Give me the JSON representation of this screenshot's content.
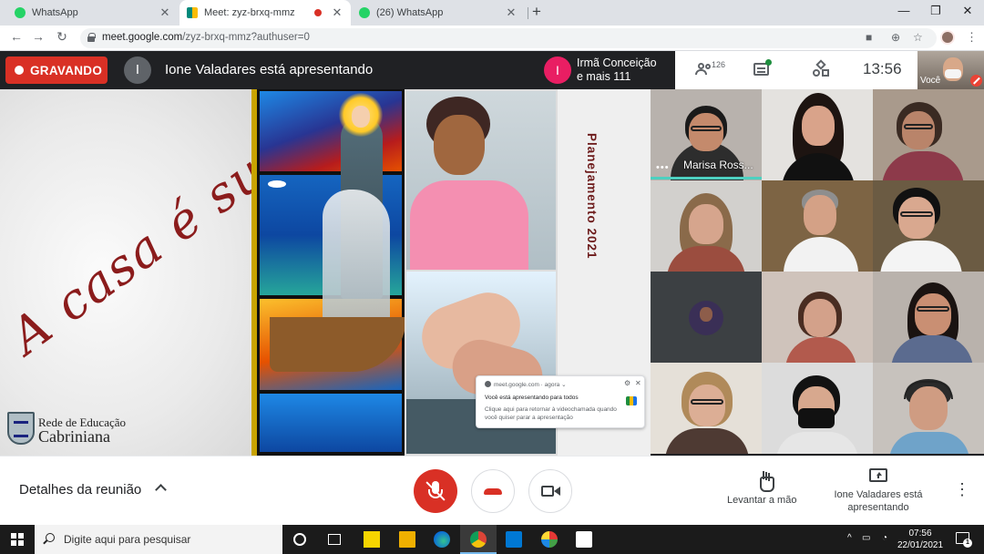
{
  "browser": {
    "tabs": [
      {
        "title": "WhatsApp",
        "favicon_color": "#25d366"
      },
      {
        "title": "Meet: zyz-brxq-mmz",
        "favicon_color": "#00897b"
      },
      {
        "title": "(26) WhatsApp",
        "favicon_color": "#25d366"
      }
    ],
    "new_tab_label": "+",
    "url_host": "meet.google.com",
    "url_path": "/zyz-brxq-mmz?authuser=0"
  },
  "meet_top": {
    "recording_label": "GRAVANDO",
    "presenter_initial": "I",
    "presenter_text": "Ione Valadares está apresentando",
    "speaker_initial": "I",
    "speaker_line1": "Irmã Conceição",
    "speaker_line2": "e mais 111",
    "participants_count": "126",
    "clock": "13:56",
    "self_label": "Você"
  },
  "slide": {
    "script_title": "A casa é sua",
    "logo_line1": "Rede de Educação",
    "logo_line2": "Cabriniana",
    "vertical_title": "Planejamento 2021"
  },
  "notification": {
    "source": "meet.google.com · agora ⌄",
    "line1": "Você está apresentando para todos",
    "line2": "Clique aqui para retornar à videochamada quando você quiser parar a apresentação"
  },
  "grid": {
    "tiles": [
      {
        "name": "Marisa Ross...",
        "bg": "#b8b2ad"
      },
      {
        "name": "",
        "bg": "#e4e2df"
      },
      {
        "name": "",
        "bg": "#a99a8c"
      },
      {
        "name": "",
        "bg": "#d2d0cd"
      },
      {
        "name": "",
        "bg": "#7d6444"
      },
      {
        "name": "",
        "bg": "#6b5b43"
      },
      {
        "name": "",
        "bg": "#3c4043"
      },
      {
        "name": "",
        "bg": "#cfc3bb"
      },
      {
        "name": "",
        "bg": "#b9b2ac"
      },
      {
        "name": "",
        "bg": "#e5e0d8"
      },
      {
        "name": "",
        "bg": "#dcdcdc"
      },
      {
        "name": "",
        "bg": "#c7c2bd"
      }
    ]
  },
  "bottom": {
    "details_label": "Detalhes da reunião",
    "raise_hand_label": "Levantar a mão",
    "presenting_label": "Ione Valadares está apresentando"
  },
  "taskbar": {
    "search_placeholder": "Digite aqui para pesquisar",
    "time": "07:56",
    "date": "22/01/2021",
    "notifications_count": "1"
  },
  "colors": {
    "recording_red": "#d93025",
    "meet_dark": "#202124",
    "active_speaker_border": "#4dd0c0"
  }
}
